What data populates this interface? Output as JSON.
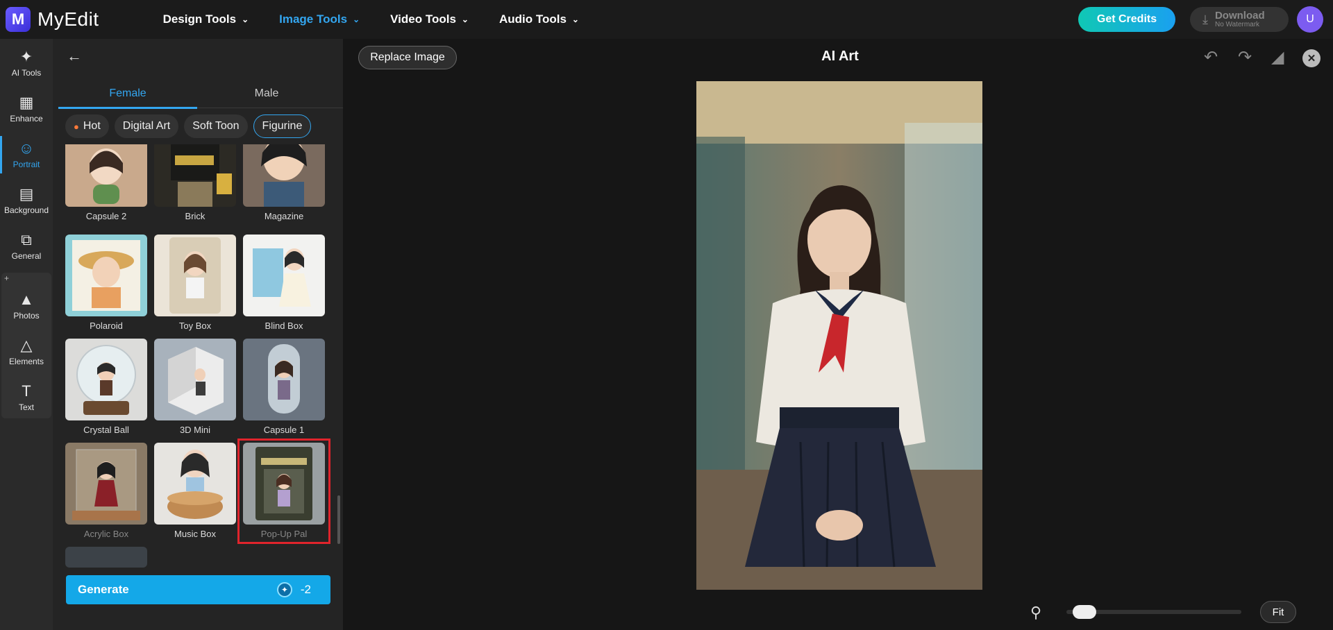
{
  "app": {
    "name": "MyEdit",
    "logo_letter": "M"
  },
  "nav": [
    {
      "label": "Design Tools",
      "active": false
    },
    {
      "label": "Image Tools",
      "active": true
    },
    {
      "label": "Video Tools",
      "active": false
    },
    {
      "label": "Audio Tools",
      "active": false
    }
  ],
  "header": {
    "credits_label": "Get Credits",
    "download_label": "Download",
    "download_sub": "No Watermark",
    "avatar_letter": "U"
  },
  "rail": [
    {
      "label": "AI Tools",
      "icon": "magic-wand-icon",
      "active": false
    },
    {
      "label": "Enhance",
      "icon": "enhance-icon",
      "active": false
    },
    {
      "label": "Portrait",
      "icon": "portrait-icon",
      "active": true
    },
    {
      "label": "Background",
      "icon": "background-icon",
      "active": false
    },
    {
      "label": "General",
      "icon": "general-icon",
      "active": false
    },
    {
      "label": "Photos",
      "icon": "photos-icon",
      "active": false
    },
    {
      "label": "Elements",
      "icon": "elements-icon",
      "active": false
    },
    {
      "label": "Text",
      "icon": "text-icon",
      "active": false
    }
  ],
  "panel": {
    "gender_tabs": [
      {
        "label": "Female",
        "active": true
      },
      {
        "label": "Male",
        "active": false
      }
    ],
    "chips": [
      {
        "label": "Hot",
        "active": false
      },
      {
        "label": "Digital Art",
        "active": false
      },
      {
        "label": "Soft Toon",
        "active": false
      },
      {
        "label": "Figurine",
        "active": true
      }
    ],
    "styles": [
      {
        "label": "Capsule 2"
      },
      {
        "label": "Brick"
      },
      {
        "label": "Magazine"
      },
      {
        "label": "Polaroid"
      },
      {
        "label": "Toy Box"
      },
      {
        "label": "Blind Box"
      },
      {
        "label": "Crystal Ball"
      },
      {
        "label": "3D Mini"
      },
      {
        "label": "Capsule 1"
      },
      {
        "label": "Acrylic Box"
      },
      {
        "label": "Music Box"
      },
      {
        "label": "Pop-Up Pal",
        "selected": true
      }
    ],
    "generate_label": "Generate",
    "generate_cost": "-2"
  },
  "canvas": {
    "replace_label": "Replace Image",
    "title": "AI Art",
    "fit_label": "Fit",
    "zoom_level": 0.05
  },
  "colors": {
    "accent": "#33a6f0",
    "highlight": "#e0242c",
    "generate": "#14a8e8"
  }
}
